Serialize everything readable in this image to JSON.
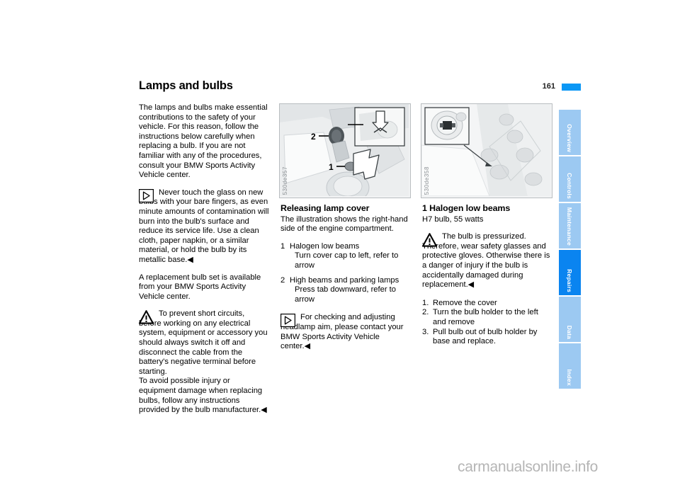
{
  "header": {
    "title": "Lamps and bulbs",
    "page_number": "161",
    "accent_color": "#0a97f5"
  },
  "column_1": {
    "intro": "The lamps and bulbs make essential contributions to the safety of your vehicle. For this reason, follow the instructions below carefully when replacing a bulb. If you are not familiar with any of the procedures, consult your BMW Sports Activity Vehicle center.",
    "note_bulb_glass": {
      "icon": "note-pointer-icon",
      "text": "Never touch the glass on new bulbs with your bare fingers, as even minute amounts of contamination will burn into the bulb's surface and reduce its service life. Use a clean cloth, paper napkin, or a similar material, or hold the bulb by its metallic base.◀"
    },
    "replacement_set": "A replacement bulb set is available from your BMW Sports Activity Vehicle center.",
    "warning_short_circuits": {
      "icon": "warning-triangle-icon",
      "text": "To prevent short circuits, before working on any electrical system, equipment or accessory you should always switch it off and disconnect the cable from the battery's negative terminal before starting.\nTo avoid possible injury or equipment damage when replacing bulbs, follow any instructions provided by the bulb manufacturer.◀"
    }
  },
  "figure_1": {
    "caption": "530de357",
    "callout_1": "1",
    "callout_2": "2",
    "alt": "Right-hand side of engine compartment showing lamp cover"
  },
  "figure_2": {
    "caption": "530de358",
    "alt": "Halogen low beam bulb holder detail"
  },
  "column_2": {
    "subhead": "Releasing lamp cover",
    "intro": "The illustration shows the right-hand side of the engine compartment.",
    "items": [
      {
        "num": "1",
        "title": "Halogen low beams",
        "sub": "Turn cover cap to left, refer to arrow"
      },
      {
        "num": "2",
        "title": "High beams and parking lamps",
        "sub": "Press tab downward, refer to arrow"
      }
    ],
    "note_headlamp_aim": {
      "icon": "note-pointer-icon",
      "text": "For checking and adjusting headlamp aim, please contact your BMW Sports Activity Vehicle center.◀"
    }
  },
  "column_3": {
    "subhead": "1 Halogen low beams",
    "spec": "H7 bulb, 55 watts",
    "warning_pressurized": {
      "icon": "warning-triangle-icon",
      "text": "The bulb is pressurized. Therefore, wear safety glasses and protective gloves. Otherwise there is a danger of injury if the bulb is accidentally damaged during replacement.◀"
    },
    "steps": [
      {
        "num": "1.",
        "text": "Remove the cover"
      },
      {
        "num": "2.",
        "text": "Turn the bulb holder to the left and remove"
      },
      {
        "num": "3.",
        "text": "Pull bulb out of bulb holder by base and replace."
      }
    ]
  },
  "tabs": [
    {
      "label": "Overview",
      "active": false
    },
    {
      "label": "Controls",
      "active": false
    },
    {
      "label": "Maintenance",
      "active": false
    },
    {
      "label": "Repairs",
      "active": true
    },
    {
      "label": "Data",
      "active": false
    },
    {
      "label": "Index",
      "active": false
    }
  ],
  "tab_colors": {
    "inactive": "#9cc9f2",
    "active": "#0a84f0"
  },
  "watermark": "carmanualsonline.info"
}
